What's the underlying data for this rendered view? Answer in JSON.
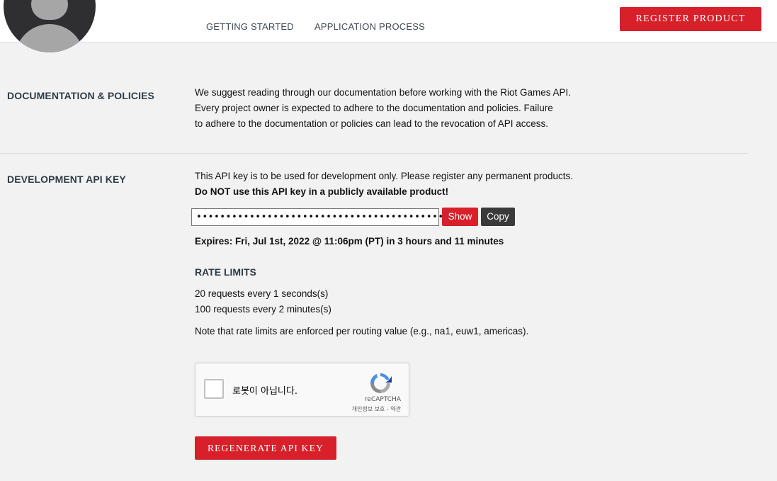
{
  "header": {
    "nav": {
      "getting_started": "GETTING STARTED",
      "application_process": "APPLICATION PROCESS"
    },
    "register_button": "REGISTER PRODUCT"
  },
  "documentation": {
    "title": "DOCUMENTATION & POLICIES",
    "lines": [
      "We suggest reading through our documentation before working with the Riot Games API.",
      "Every project owner is expected to adhere to the documentation and policies. Failure",
      "to adhere to the documentation or policies can lead to the revocation of API access."
    ]
  },
  "dev_key": {
    "title": "DEVELOPMENT API KEY",
    "notice": "This API key is to be used for development only. Please register any permanent products.",
    "warning": "Do NOT use this API key in a publicly available product!",
    "key_masked": "•••••••••••••••••••••••••••••••••••••••••••",
    "show_button": "Show",
    "copy_button": "Copy",
    "expires": "Expires: Fri, Jul 1st, 2022 @ 11:06pm (PT) in 3 hours and 11 minutes"
  },
  "rate_limits": {
    "title": "RATE LIMITS",
    "lines": [
      "20 requests every 1 seconds(s)",
      "100 requests every 2 minutes(s)"
    ],
    "note": "Note that rate limits are enforced per routing value (e.g., na1, euw1, americas)."
  },
  "captcha": {
    "label": "로봇이 아닙니다.",
    "brand": "reCAPTCHA",
    "terms": "개인정보 보호 - 약관",
    "logo_icon": "recaptcha-icon"
  },
  "regenerate_button": "REGENERATE API KEY",
  "colors": {
    "accent_red": "#d7202a",
    "copy_button": "#3a3a3a",
    "heading": "#2f3c48",
    "background": "#f2f2f2"
  }
}
